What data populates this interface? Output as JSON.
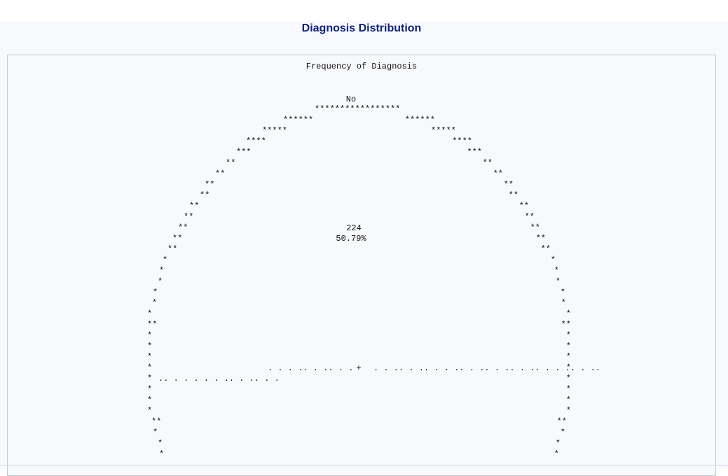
{
  "page": {
    "title": "Diagnosis Distribution"
  },
  "chart_data": {
    "type": "pie",
    "title": "Frequency of Diagnosis",
    "style": "ascii-line-printer",
    "slices": [
      {
        "label": "No",
        "count": 224,
        "percent": "50.79%"
      }
    ],
    "symbols": {
      "outline": "*",
      "divider": ".",
      "center": "+"
    }
  }
}
